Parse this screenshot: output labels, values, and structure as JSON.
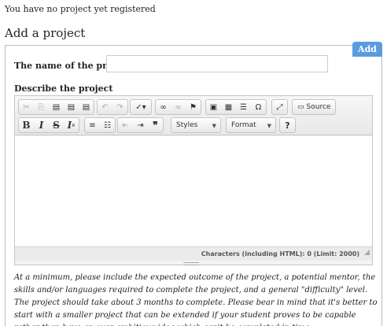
{
  "status_message": "You have no project yet registered",
  "section_title": "Add a project",
  "add_tab_label": "Add",
  "form": {
    "name_label": "The name of the project",
    "required_marker": "*",
    "name_value": "",
    "describe_label": "Describe the project"
  },
  "toolbar": {
    "row1": [
      {
        "name": "cut-icon",
        "glyph": "✂",
        "disabled": true
      },
      {
        "name": "copy-icon",
        "glyph": "⎘",
        "disabled": true
      },
      {
        "name": "paste-icon",
        "glyph": "📋",
        "disabled": false
      },
      {
        "name": "paste-text-icon",
        "glyph": "📋",
        "disabled": false
      },
      {
        "name": "paste-word-icon",
        "glyph": "📋",
        "disabled": false
      },
      {
        "name": "undo-icon",
        "glyph": "↶",
        "disabled": true
      },
      {
        "name": "redo-icon",
        "glyph": "↷",
        "disabled": true
      },
      {
        "name": "spellcheck-icon",
        "glyph": "✓",
        "disabled": false
      },
      {
        "name": "link-icon",
        "glyph": "⛓",
        "disabled": false
      },
      {
        "name": "unlink-icon",
        "glyph": "⛓",
        "disabled": true
      },
      {
        "name": "anchor-flag-icon",
        "glyph": "⚑",
        "disabled": false
      },
      {
        "name": "image-icon",
        "glyph": "▣",
        "disabled": false
      },
      {
        "name": "table-icon",
        "glyph": "▦",
        "disabled": false
      },
      {
        "name": "horizontal-line-icon",
        "glyph": "☰",
        "disabled": false
      },
      {
        "name": "special-char-icon",
        "glyph": "Ω",
        "disabled": false
      },
      {
        "name": "maximize-icon",
        "glyph": "⤢",
        "disabled": false
      }
    ],
    "source_label": "Source",
    "row2": [
      {
        "name": "bold-icon",
        "glyph": "B"
      },
      {
        "name": "italic-icon",
        "glyph": "I"
      },
      {
        "name": "strike-icon",
        "glyph": "S"
      },
      {
        "name": "remove-format-icon",
        "glyph": "Tx"
      },
      {
        "name": "numbered-list-icon",
        "glyph": "≡"
      },
      {
        "name": "bulleted-list-icon",
        "glyph": "☷"
      },
      {
        "name": "outdent-icon",
        "glyph": "⇤"
      },
      {
        "name": "indent-icon",
        "glyph": "⇥"
      },
      {
        "name": "blockquote-icon",
        "glyph": "❞"
      }
    ],
    "styles_label": "Styles",
    "format_label": "Format",
    "help_glyph": "?"
  },
  "char_counter": "Characters (including HTML): 0 (Limit: 2000)",
  "help_text": "At a minimum, please include the expected outcome of the project, a potential mentor, the skills and/or languages required to complete the project, and a general \"difficulty\" level. The project should take about 3 months to complete. Please bear in mind that it's better to start with a smaller project that can be extended if your student proves to be capable rather than have an over-ambitious idea which can't be completed in time."
}
